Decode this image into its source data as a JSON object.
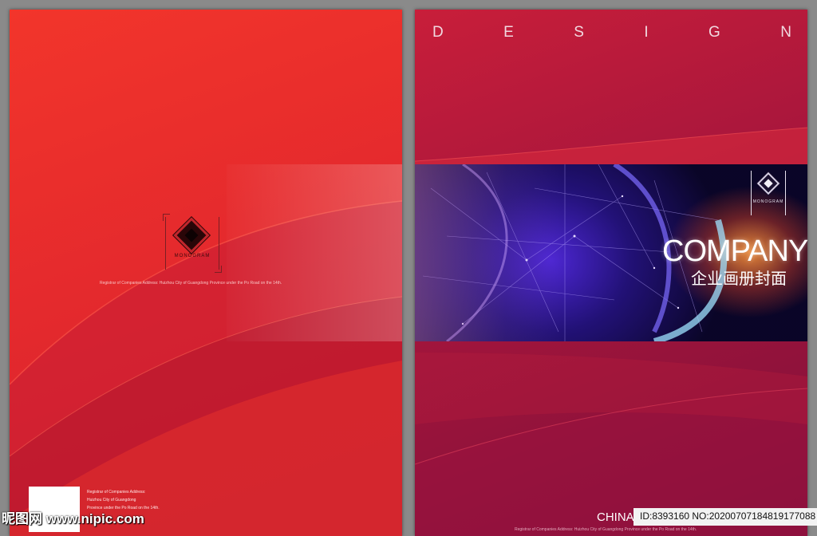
{
  "left_page": {
    "monogram_title": "MONOGRAM",
    "address_line": "Registrar of Companies Address: Huizhou City of Guangdong Province under the Po Road on the 14th.",
    "registrar": {
      "heading": "Registrar of Companies Address:",
      "line1": "Huizhou City of Guangdong",
      "line2": "Province under the Po Road on the 14th."
    }
  },
  "right_page": {
    "design_letters": [
      "D",
      "E",
      "S",
      "I",
      "G",
      "N"
    ],
    "hero": {
      "monogram_title": "MONOGRAM",
      "company": "COMPANY",
      "company_cn": "企业画册封面"
    },
    "china": "CHINA",
    "address_line": "Registrar of Companies Address: Huizhou City of Guangdong Province under the Po Road on the 14th."
  },
  "overlays": {
    "watermark": "昵图网 www.nipic.com",
    "id_text": "ID:8393160 NO:20200707184819177088"
  },
  "colors": {
    "left_page_red": "#e52a2d",
    "right_page_crimson": "#a8163c",
    "canvas_gray": "#8a8a8a",
    "hero_blue": "#3a22c8"
  }
}
